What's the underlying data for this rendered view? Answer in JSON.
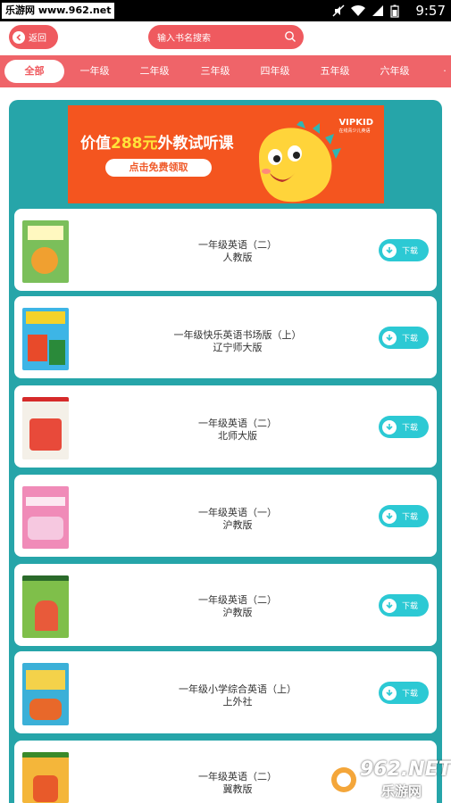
{
  "status_bar": {
    "watermark": "乐游网 www.962.net",
    "time": "9:57"
  },
  "header": {
    "back_label": "返回",
    "search_placeholder": "输入书名搜索"
  },
  "tabs": [
    "全部",
    "一年级",
    "二年级",
    "三年级",
    "四年级",
    "五年级",
    "六年级"
  ],
  "active_tab": "全部",
  "banner": {
    "text_prefix": "价值",
    "text_highlight": "288元",
    "text_suffix": "外教试听课",
    "button": "点击免费领取",
    "logo": "VIPKID",
    "logo_sub": "在线青少儿英语"
  },
  "books": [
    {
      "title": "一年级英语（二）",
      "publisher": "人教版",
      "download": "下载",
      "cover_color": "#7bbf5a"
    },
    {
      "title": "一年级快乐英语书场版（上）",
      "publisher": "辽宁师大版",
      "download": "下载",
      "cover_color": "#3db5e6"
    },
    {
      "title": "一年级英语（二）",
      "publisher": "北师大版",
      "download": "下载",
      "cover_color": "#f4f0e8"
    },
    {
      "title": "一年级英语（一）",
      "publisher": "沪教版",
      "download": "下载",
      "cover_color": "#f08bb8"
    },
    {
      "title": "一年级英语（二）",
      "publisher": "沪教版",
      "download": "下载",
      "cover_color": "#7fbf4a"
    },
    {
      "title": "一年级小学综合英语（上）",
      "publisher": "上外社",
      "download": "下载",
      "cover_color": "#3bb0d8"
    },
    {
      "title": "一年级英语（二）",
      "publisher": "冀教版",
      "download": "下载",
      "cover_color": "#f4b63a"
    }
  ],
  "footer_watermark": {
    "logo": "962.NET",
    "label": "乐游网"
  },
  "colors": {
    "primary": "#ef5a5f",
    "tabs_bg": "#ef6469",
    "panel": "#26a5a9",
    "download": "#2cc9d4"
  }
}
